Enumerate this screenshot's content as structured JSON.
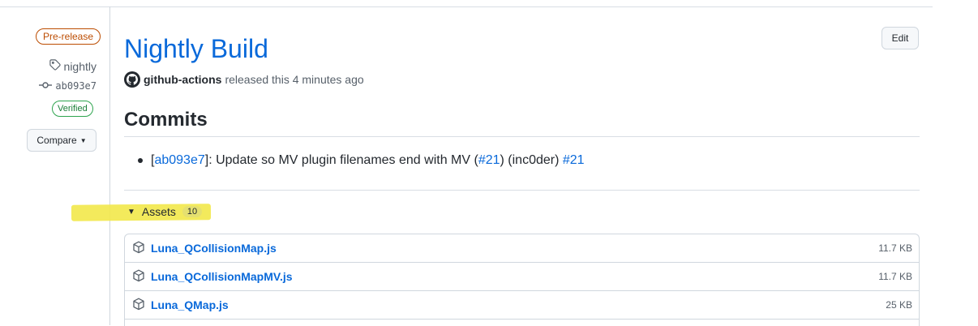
{
  "release": {
    "status_badge": "Pre-release",
    "tag": "nightly",
    "commit_sha": "ab093e7",
    "verified_badge": "Verified",
    "compare_label": "Compare",
    "title": "Nightly Build",
    "edit_label": "Edit",
    "author": "github-actions",
    "released_text": "released this 4 minutes ago"
  },
  "commits": {
    "heading": "Commits",
    "items": [
      {
        "open_bracket": "[",
        "sha": "ab093e7",
        "close_bracket": "]",
        "message": ": Update so MV plugin filenames end with MV (",
        "pr_ref": "#21",
        "author_part": ") (inc0der) ",
        "pr_link": "#21"
      }
    ]
  },
  "assets": {
    "label": "Assets",
    "count": "10",
    "files": [
      {
        "name": "Luna_QCollisionMap.js",
        "size": "11.7 KB"
      },
      {
        "name": "Luna_QCollisionMapMV.js",
        "size": "11.7 KB"
      },
      {
        "name": "Luna_QMap.js",
        "size": "25 KB"
      }
    ]
  },
  "colors": {
    "link": "#0969da",
    "prerelease": "#bc4c00",
    "verified": "#1a7f37",
    "highlight": "#f2e84a"
  }
}
